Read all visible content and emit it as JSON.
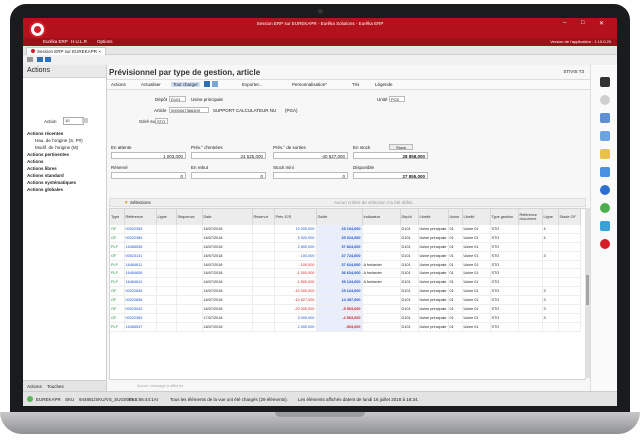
{
  "window": {
    "title": "Session ERP sur EUREKAPR - Eurêka Solutions - Eurêka ERP",
    "menu": [
      "Eurêka ERP",
      "H.U.L.R",
      "Options"
    ],
    "version": "Version de l'application : 1.10.0.20",
    "controls": [
      "–",
      "□",
      "✕"
    ]
  },
  "tab": {
    "label": "Session ERP sur EUREKAPR"
  },
  "left_panel": {
    "title": "Actions",
    "action_label": "Action",
    "action_value": "10",
    "items": [
      {
        "label": "Actions récentes",
        "bold": true
      },
      {
        "label": "Hau. de l'origine (S, P#)",
        "bold": false
      },
      {
        "label": "Modif. de l'origine (M)",
        "bold": false
      },
      {
        "label": "Actions pertinentes",
        "bold": true
      },
      {
        "label": "Actions",
        "bold": true
      },
      {
        "label": "Actions libres",
        "bold": true
      },
      {
        "label": "Actions standard",
        "bold": true
      },
      {
        "label": "Actions systématiques",
        "bold": true
      },
      {
        "label": "Actions globales",
        "bold": true
      }
    ],
    "footer_tabs": [
      "Actions",
      "Touches"
    ]
  },
  "main": {
    "title": "Prévisionnel par type de gestion, article",
    "user": "STIVIS T3",
    "toolbar": [
      "Actions",
      "Actualiser",
      "Tout charger",
      "Exporter...",
      "Personnalisation*",
      "Tris",
      "Légende"
    ],
    "form": {
      "depot_label": "Dépôt",
      "depot_value": "D101",
      "depot_name": "Usine principale",
      "unite_label": "Unité",
      "unite_value": "PCE",
      "article_label": "Article",
      "article_value": "0000067366309",
      "article_desc": "SUPPORT CALCULATEUR NU",
      "article_extra": "(PGA)",
      "gere_label": "Géré sur",
      "gere_value": "STO"
    },
    "summary": {
      "en_attente_label": "En attente",
      "en_attente_value": "1 003,000",
      "prev_entree_label": "Prév.° d'entrées",
      "prev_entree_value": "24 525,000",
      "prev_sortie_label": "Prév.° de sorties",
      "prev_sortie_value": "-40 627,000",
      "en_stock_label": "En stock",
      "en_stock_value": "28 858,000",
      "reserve_label": "Réservé",
      "reserve_value": "0",
      "en_rebut_label": "En rebut",
      "en_rebut_value": "0",
      "stock_mini_label": "Stock mini",
      "stock_mini_value": "0",
      "disponible_label": "Disponible",
      "disponible_value": "27 855,000",
      "stock_button": "Stock"
    },
    "selection": {
      "label": "Sélections",
      "hint": "Aucun critère de sélection n'a été défini."
    },
    "grid": {
      "columns": [
        "Type",
        "Référence",
        "Ligne",
        "Séquence",
        "Date",
        "Réserv.é",
        "Prév. E/S",
        "Solde",
        "Indicateur",
        "Dépôt",
        "Libellé",
        "Usine",
        "Libellé",
        "Type gestion",
        "Référence document",
        "Ligne",
        "Stade OF"
      ],
      "rows": [
        [
          "OF",
          "00022355",
          "",
          "",
          "16/07/2018",
          "",
          "10 000,000",
          "25 104,000",
          "",
          "D101",
          "Usine principale",
          "01",
          "Usine 01",
          "STO",
          "",
          "4",
          ""
        ],
        [
          "OF",
          "00022385",
          "",
          "",
          "16/07/2018",
          "",
          "9 920,000",
          "35 024,000",
          "",
          "D101",
          "Usine principale",
          "01",
          "Usine 01",
          "STO",
          "",
          "4",
          ""
        ],
        [
          "PLF",
          "16465536",
          "",
          "",
          "16/07/2018",
          "",
          "2 800,000",
          "37 824,000",
          "",
          "D101",
          "Usine principale",
          "01",
          "Usine 01",
          "STO",
          "",
          "",
          ""
        ],
        [
          "OF",
          "00023141",
          "",
          "",
          "16/07/2018",
          "",
          "100,000",
          "37 724,000",
          "",
          "D101",
          "Usine principale",
          "01",
          "Usine 01",
          "STO",
          "",
          "3",
          ""
        ],
        [
          "PLF",
          "16464811",
          "",
          "",
          "16/07/2018",
          "",
          "-100,000",
          "37 624,000",
          "A fonlarder",
          "D101",
          "Usine principale",
          "01",
          "Usine 01",
          "STO",
          "",
          "",
          ""
        ],
        [
          "PLF",
          "16464808",
          "",
          "",
          "16/07/2018",
          "",
          "-1 000,000",
          "36 624,000",
          "A fonlarder",
          "D101",
          "Usine principale",
          "01",
          "Usine 01",
          "STO",
          "",
          "",
          ""
        ],
        [
          "PLF",
          "16464810",
          "",
          "",
          "16/07/2018",
          "",
          "-1 500,000",
          "35 124,000",
          "A fonlarder",
          "D101",
          "Usine principale",
          "01",
          "Usine 01",
          "STO",
          "",
          "",
          ""
        ],
        [
          "OF",
          "00022836",
          "",
          "",
          "16/07/2018",
          "",
          "-10 000,000",
          "25 124,000",
          "",
          "D101",
          "Usine principale",
          "01",
          "Usine 01",
          "STO",
          "",
          "3",
          ""
        ],
        [
          "OF",
          "00022836",
          "",
          "",
          "16/07/2018",
          "",
          "-10 627,000",
          "14 497,000",
          "",
          "D101",
          "Usine principale",
          "01",
          "Usine 01",
          "STO",
          "",
          "3",
          ""
        ],
        [
          "OF",
          "00023040",
          "",
          "",
          "16/07/2018",
          "",
          "-20 000,000",
          "-5 503,000",
          "",
          "D101",
          "Usine principale",
          "01",
          "Usine 01",
          "STO",
          "",
          "3",
          ""
        ],
        [
          "OF",
          "00022369",
          "",
          "",
          "17/07/2018",
          "",
          "3 000,000",
          "-2 503,000",
          "",
          "D101",
          "Usine principale",
          "01",
          "Usine 01",
          "STO",
          "",
          "3",
          ""
        ],
        [
          "PLF",
          "16465537",
          "",
          "",
          "18/07/2018",
          "",
          "2 000,000",
          "-503,000",
          "",
          "D101",
          "Usine principale",
          "01",
          "Usine 01",
          "STO",
          "",
          "",
          ""
        ]
      ]
    },
    "message_hint": "Aucun message à afficher"
  },
  "status": {
    "server": "EUREKAPR",
    "company": "SKU",
    "session": "944881/SKU/VS_SUG0001",
    "pc": "FAB:55:44:1AI",
    "message": "Tous les éléments de la vue ont été chargés (29 éléments).",
    "info": "Les éléments affichés datent de lundi 16 juillet 2018 à 16:34."
  },
  "colors": {
    "titlebar": "#b3111b",
    "menubar": "#9e0f18",
    "positive": "#1d4fd0",
    "negative": "#d01f1f",
    "type": "#1b8f3a"
  },
  "dock_icons": [
    "monitor-icon",
    "search-icon",
    "documents-icon",
    "report-icon",
    "calendar-icon",
    "chart-icon",
    "user-icon",
    "help-icon",
    "settings-icon",
    "alert-icon"
  ]
}
